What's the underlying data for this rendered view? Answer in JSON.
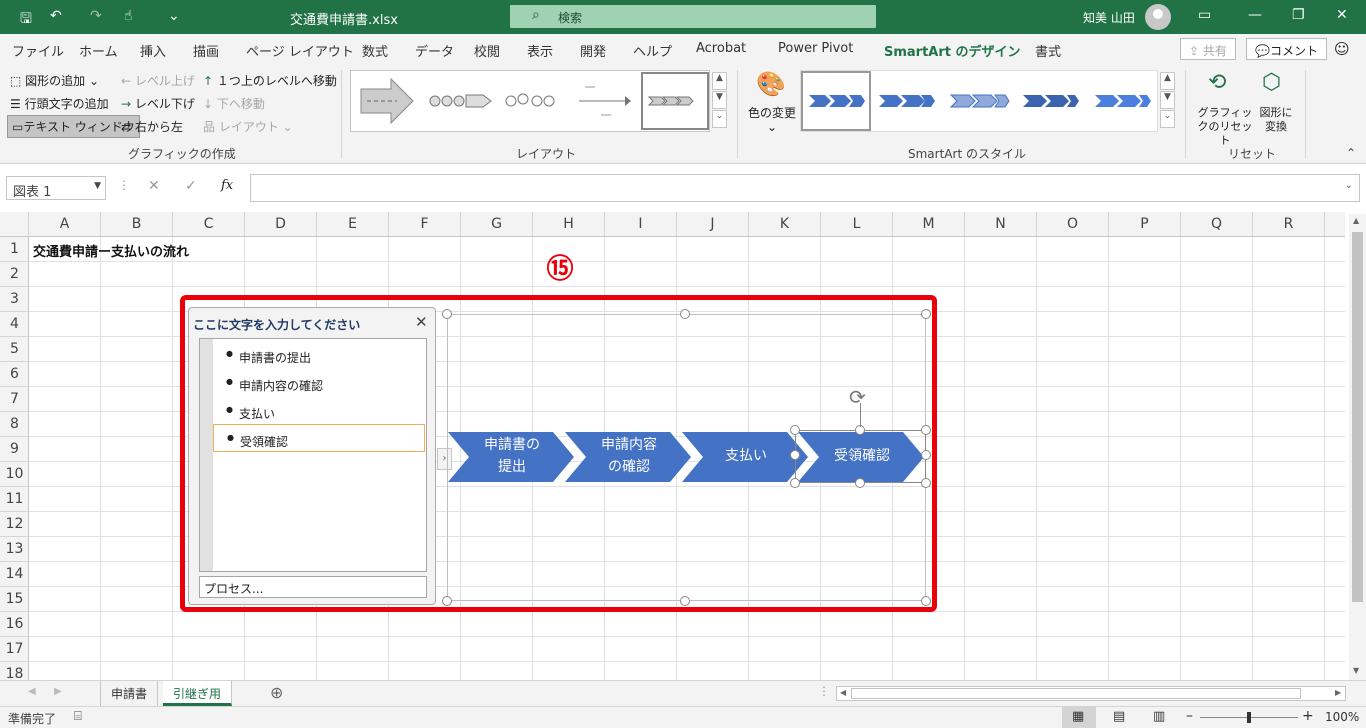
{
  "app": {
    "title": "交通費申請書.xlsx",
    "search_placeholder": "検索",
    "user_name": "知美 山田"
  },
  "tabs": [
    "ファイル",
    "ホーム",
    "挿入",
    "描画",
    "ページ レイアウト",
    "数式",
    "データ",
    "校閲",
    "表示",
    "開発",
    "ヘルプ",
    "Acrobat",
    "Power Pivot",
    "SmartArt のデザイン",
    "書式"
  ],
  "share_label": "共有",
  "comment_label": "コメント",
  "ribbon": {
    "create_graphic": {
      "add_shape": "図形の追加",
      "add_bullet": "行頭文字の追加",
      "text_pane": "テキスト ウィンドウ",
      "promote": "レベル上げ",
      "demote": "レベル下げ",
      "right_to_left": "右から左",
      "move_up": "１つ上のレベルへ移動",
      "move_down": "下へ移動",
      "layout": "レイアウト",
      "group_label": "グラフィックの作成"
    },
    "layouts_group_label": "レイアウト",
    "change_colors": "色の変更",
    "styles_group_label": "SmartArt のスタイル",
    "reset_graphic": "グラフィックのリセット",
    "convert_to_shapes": "図形に変換",
    "reset_group_label": "リセット"
  },
  "formula_bar": {
    "name_box": "図表 1",
    "fx": "fx"
  },
  "columns": [
    "A",
    "B",
    "C",
    "D",
    "E",
    "F",
    "G",
    "H",
    "I",
    "J",
    "K",
    "L",
    "M",
    "N",
    "O",
    "P",
    "Q",
    "R"
  ],
  "rows": [
    "1",
    "2",
    "3",
    "4",
    "5",
    "6",
    "7",
    "8",
    "9",
    "10",
    "11",
    "12",
    "13",
    "14",
    "15",
    "16",
    "17",
    "18"
  ],
  "cell_a1": "交通費申請ー支払いの流れ",
  "callout": "⑮",
  "text_pane": {
    "title": "ここに文字を入力してください",
    "items": [
      "申請書の提出",
      "申請内容の確認",
      "支払い",
      "受領確認"
    ],
    "footer": "プロセス..."
  },
  "smartart": {
    "shapes": [
      {
        "line1": "申請書の",
        "line2": "提出"
      },
      {
        "line1": "申請内容",
        "line2": "の確認"
      },
      {
        "line1": "支払い",
        "line2": ""
      },
      {
        "line1": "受領確認",
        "line2": ""
      }
    ],
    "fill_color": "#4472c4"
  },
  "sheets": [
    "申請書",
    "引継ぎ用"
  ],
  "status": {
    "ready": "準備完了",
    "zoom": "100%"
  }
}
